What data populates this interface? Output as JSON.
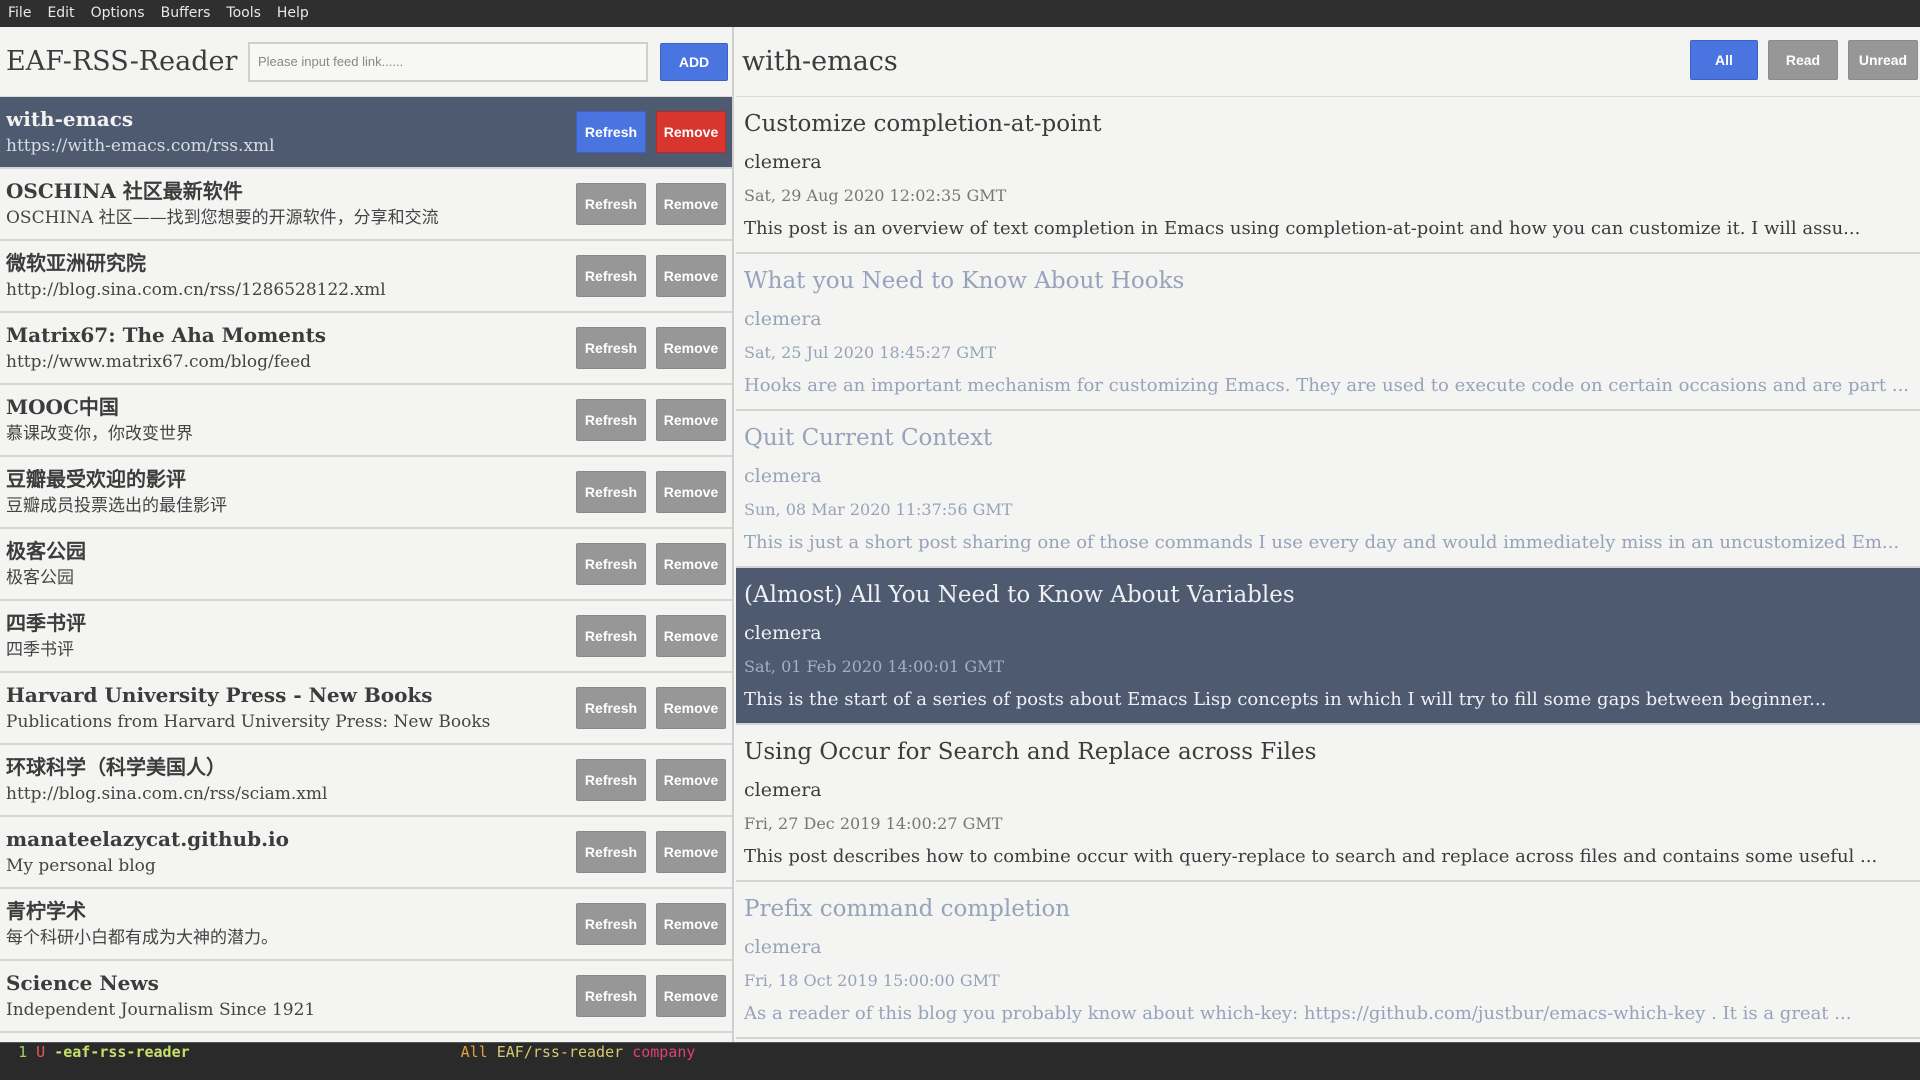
{
  "menubar": {
    "items": [
      "File",
      "Edit",
      "Options",
      "Buffers",
      "Tools",
      "Help"
    ]
  },
  "left": {
    "app_title": "EAF-RSS-Reader",
    "input_placeholder": "Please input feed link......",
    "add_label": "ADD",
    "refresh_label": "Refresh",
    "remove_label": "Remove",
    "feeds": [
      {
        "title": "with-emacs",
        "subtitle": "https://with-emacs.com/rss.xml"
      },
      {
        "title": "OSCHINA 社区最新软件",
        "subtitle": "OSCHINA 社区——找到您想要的开源软件，分享和交流"
      },
      {
        "title": "微软亚洲研究院",
        "subtitle": "http://blog.sina.com.cn/rss/1286528122.xml"
      },
      {
        "title": "Matrix67: The Aha Moments",
        "subtitle": "http://www.matrix67.com/blog/feed"
      },
      {
        "title": "MOOC中国",
        "subtitle": "慕课改变你，你改变世界"
      },
      {
        "title": "豆瓣最受欢迎的影评",
        "subtitle": "豆瓣成员投票选出的最佳影评"
      },
      {
        "title": "极客公园",
        "subtitle": "极客公园"
      },
      {
        "title": "四季书评",
        "subtitle": "四季书评"
      },
      {
        "title": "Harvard University Press - New Books",
        "subtitle": "Publications from Harvard University Press: New Books"
      },
      {
        "title": "环球科学（科学美国人）",
        "subtitle": "http://blog.sina.com.cn/rss/sciam.xml"
      },
      {
        "title": "manateelazycat.github.io",
        "subtitle": "My personal blog"
      },
      {
        "title": "青柠学术",
        "subtitle": "每个科研小白都有成为大神的潜力。"
      },
      {
        "title": "Science News",
        "subtitle": "Independent Journalism Since 1921"
      }
    ]
  },
  "right": {
    "feed_title": "with-emacs",
    "filters": {
      "all": "All",
      "read": "Read",
      "unread": "Unread"
    },
    "articles": [
      {
        "title": "Customize completion-at-point",
        "author": "clemera",
        "date": "Sat, 29 Aug 2020 12:02:35 GMT",
        "summary": "This post is an overview of text completion in Emacs using completion-at-point and how you can customize it. I will assu..."
      },
      {
        "title": "What you Need to Know About Hooks",
        "author": "clemera",
        "date": "Sat, 25 Jul 2020 18:45:27 GMT",
        "summary": "Hooks are an important mechanism for customizing Emacs. They are used to execute code on certain occasions and are part ..."
      },
      {
        "title": "Quit Current Context",
        "author": "clemera",
        "date": "Sun, 08 Mar 2020 11:37:56 GMT",
        "summary": "This is just a short post sharing one of those commands I use every day and would immediately miss in an uncustomized Em..."
      },
      {
        "title": "(Almost) All You Need to Know About Variables",
        "author": "clemera",
        "date": "Sat, 01 Feb 2020 14:00:01 GMT",
        "summary": "This is the start of a series of posts about Emacs Lisp concepts in which I will try to fill some gaps between beginner..."
      },
      {
        "title": "Using Occur for Search and Replace across Files",
        "author": "clemera",
        "date": "Fri, 27 Dec 2019 14:00:27 GMT",
        "summary": "This post describes how to combine occur with query-replace to search and replace across files and contains some useful ..."
      },
      {
        "title": "Prefix command completion",
        "author": "clemera",
        "date": "Fri, 18 Oct 2019 15:00:00 GMT",
        "summary": "As a reader of this blog you probably know about which-key: https://github.com/justbur/emacs-which-key . It is a great ..."
      }
    ]
  },
  "modeline": {
    "window_num": "1",
    "flag": "U",
    "buffer": "-eaf-rss-reader",
    "position": "All",
    "major_mode": "EAF/rss-reader",
    "minor_mode": "company"
  },
  "colors": {
    "accent": "#4a74df",
    "danger": "#d9352f",
    "selected_bg": "#4e5a70",
    "muted_button": "#979797",
    "read_text": "#96a3bb"
  }
}
